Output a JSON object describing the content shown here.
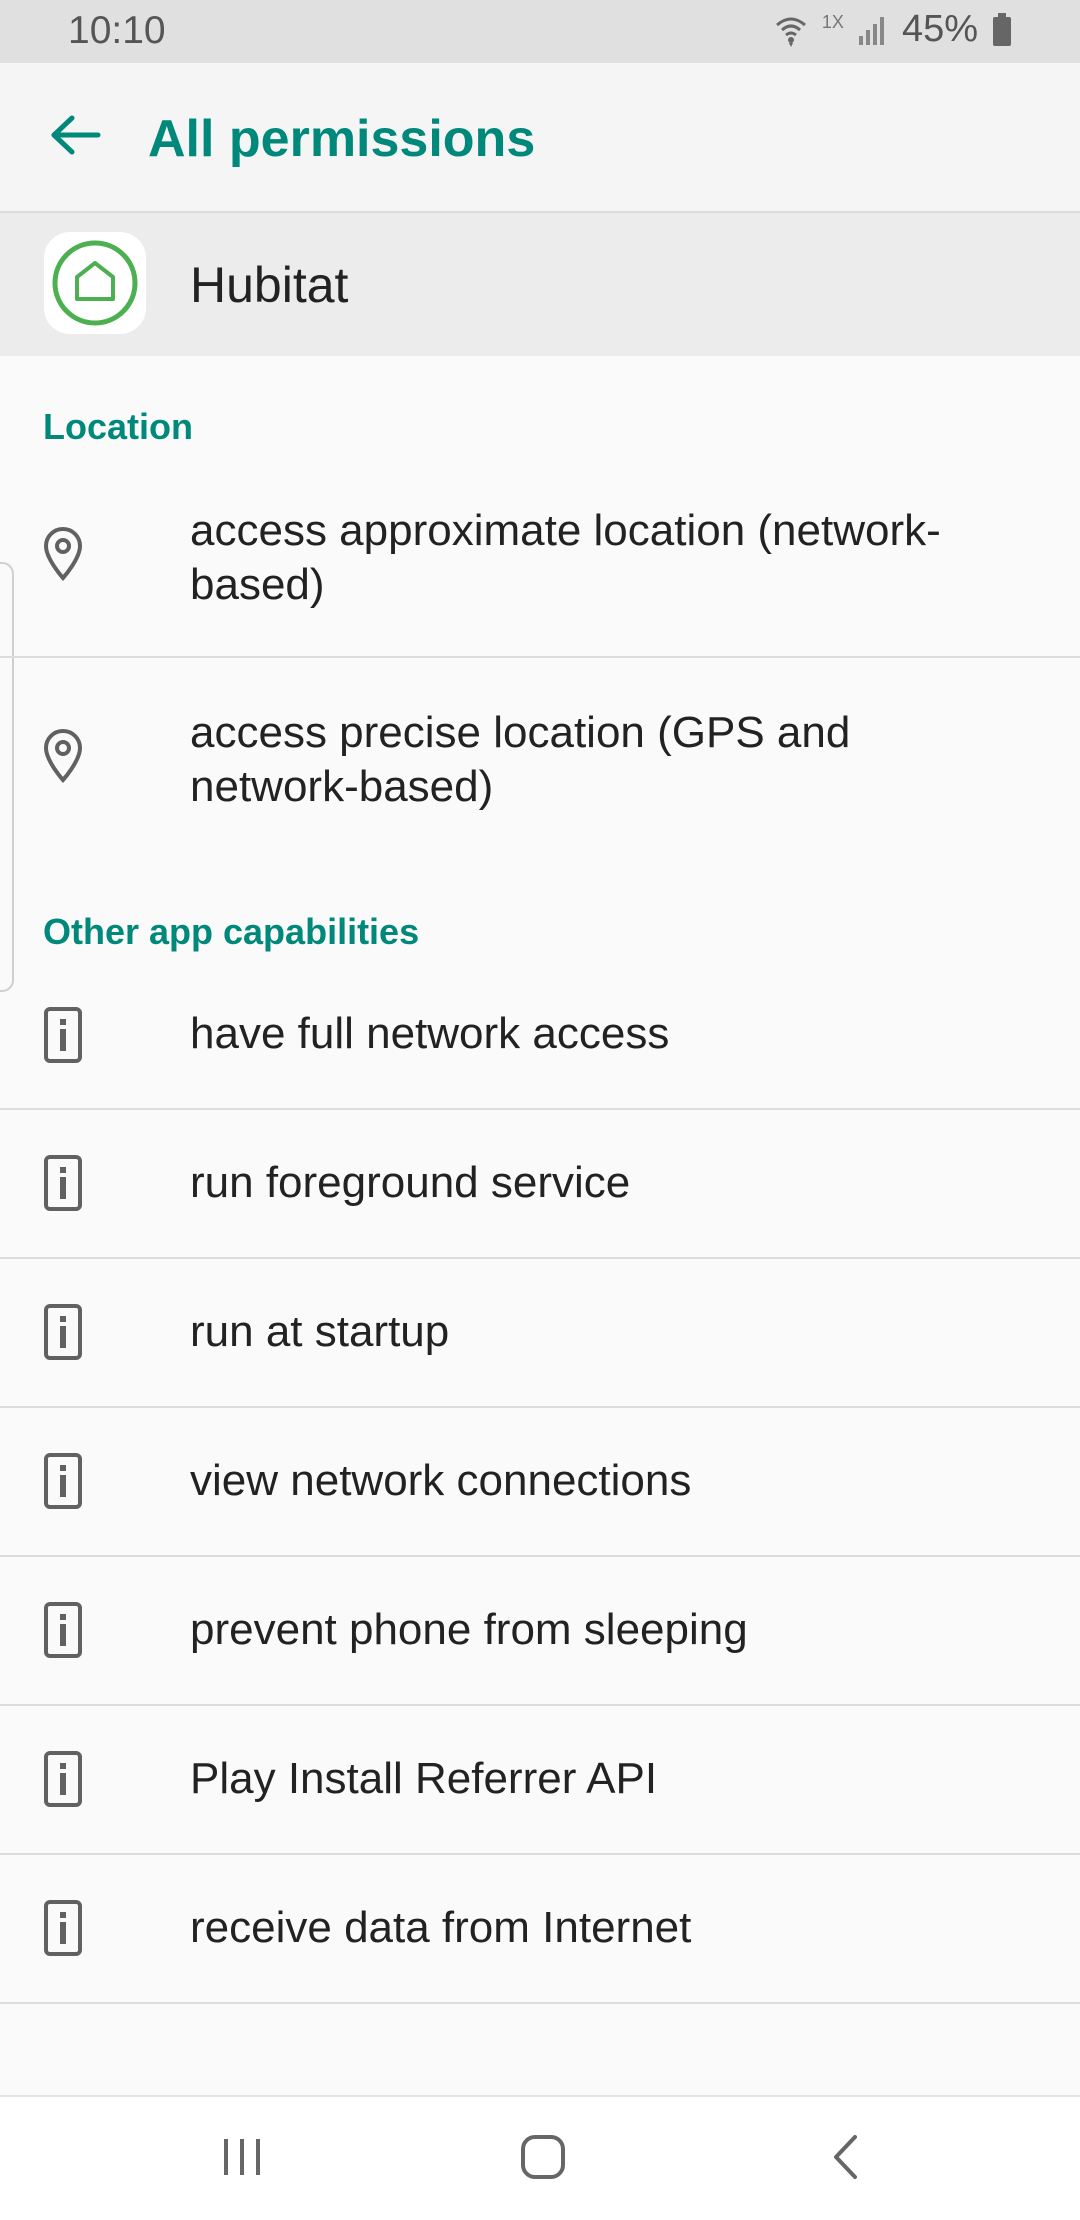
{
  "status_bar": {
    "time": "10:10",
    "network_badge": "1X",
    "battery_percent": "45%",
    "icons": [
      "wifi-icon",
      "cell-signal-icon",
      "battery-icon"
    ]
  },
  "app_bar": {
    "back_icon": "arrow-back-icon",
    "title": "All permissions"
  },
  "app": {
    "name": "Hubitat",
    "icon": "hubitat-logo-icon"
  },
  "sections": [
    {
      "title": "Location",
      "items": [
        {
          "label": "access approximate location (network-based)",
          "icon": "location-pin-icon"
        },
        {
          "label": "access precise location (GPS and network-based)",
          "icon": "location-pin-icon"
        }
      ]
    },
    {
      "title": "Other app capabilities",
      "items": [
        {
          "label": "have full network access",
          "icon": "device-info-icon"
        },
        {
          "label": "run foreground service",
          "icon": "device-info-icon"
        },
        {
          "label": "run at startup",
          "icon": "device-info-icon"
        },
        {
          "label": "view network connections",
          "icon": "device-info-icon"
        },
        {
          "label": "prevent phone from sleeping",
          "icon": "device-info-icon"
        },
        {
          "label": "Play Install Referrer API",
          "icon": "device-info-icon"
        },
        {
          "label": "receive data from Internet",
          "icon": "device-info-icon"
        }
      ]
    }
  ],
  "nav_bar": {
    "buttons": [
      "recents-icon",
      "home-icon",
      "back-icon"
    ]
  },
  "colors": {
    "accent": "#00897b",
    "status_bar": "#e0e0e0",
    "app_header": "#ececec",
    "icon_gray": "#616161",
    "logo_green": "#4caf50"
  }
}
